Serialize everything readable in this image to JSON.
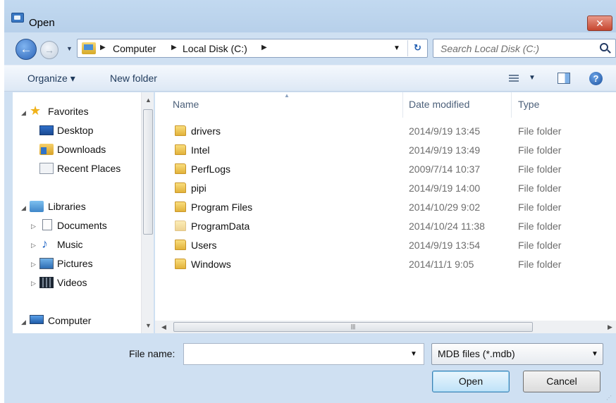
{
  "window": {
    "title": "Open",
    "close_label": "✕"
  },
  "address": {
    "crumbs": [
      "Computer",
      "Local Disk (C:)"
    ],
    "separator": "▶",
    "dropdown": "▼",
    "refresh": "↻"
  },
  "search": {
    "placeholder": "Search Local Disk (C:)"
  },
  "toolbar": {
    "organize_label": "Organize ▾",
    "new_folder_label": "New folder",
    "help": "?"
  },
  "nav": {
    "favorites": {
      "label": "Favorites",
      "items": [
        "Desktop",
        "Downloads",
        "Recent Places"
      ]
    },
    "libraries": {
      "label": "Libraries",
      "items": [
        "Documents",
        "Music",
        "Pictures",
        "Videos"
      ]
    },
    "computer": {
      "label": "Computer"
    }
  },
  "columns": {
    "name": "Name",
    "date": "Date modified",
    "type": "Type"
  },
  "files": [
    {
      "name": "drivers",
      "date": "2014/9/19 13:45",
      "type": "File folder"
    },
    {
      "name": "Intel",
      "date": "2014/9/19 13:49",
      "type": "File folder"
    },
    {
      "name": "PerfLogs",
      "date": "2009/7/14 10:37",
      "type": "File folder"
    },
    {
      "name": "pipi",
      "date": "2014/9/19 14:00",
      "type": "File folder"
    },
    {
      "name": "Program Files",
      "date": "2014/10/29 9:02",
      "type": "File folder"
    },
    {
      "name": "ProgramData",
      "date": "2014/10/24 11:38",
      "type": "File folder"
    },
    {
      "name": "Users",
      "date": "2014/9/19 13:54",
      "type": "File folder"
    },
    {
      "name": "Windows",
      "date": "2014/11/1 9:05",
      "type": "File folder"
    }
  ],
  "bottom": {
    "filename_label": "File name:",
    "filename_value": "",
    "filter_value": "MDB files (*.mdb)",
    "open_label": "Open",
    "cancel_label": "Cancel"
  },
  "colors": {
    "accent": "#3a78c3",
    "window_bg": "#cfe0f2",
    "close_red": "#c6462f"
  }
}
